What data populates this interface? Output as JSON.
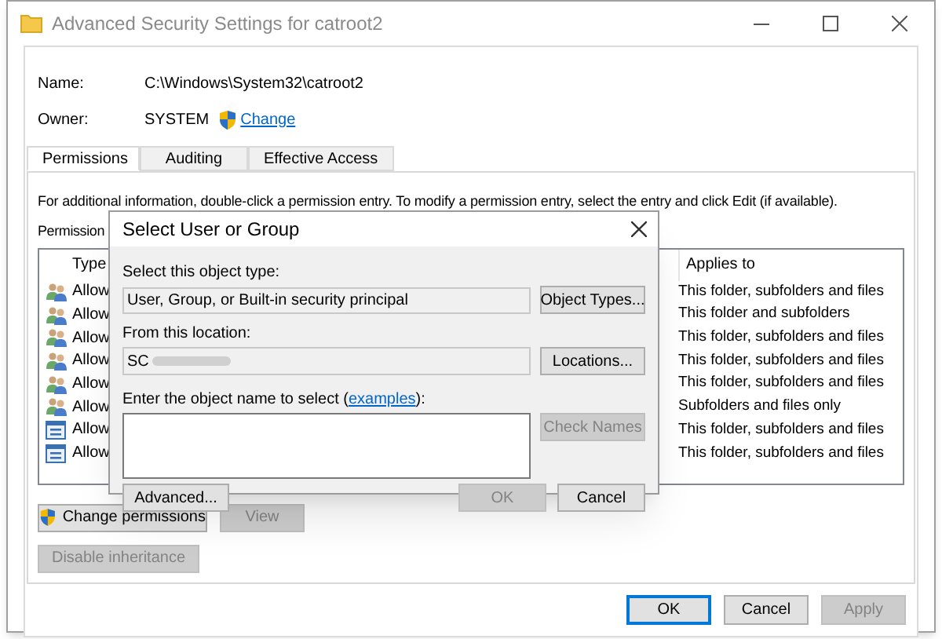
{
  "window": {
    "title": "Advanced Security Settings for catroot2"
  },
  "name": {
    "label": "Name:",
    "value": "C:\\Windows\\System32\\catroot2"
  },
  "owner": {
    "label": "Owner:",
    "value": "SYSTEM",
    "link": "Change"
  },
  "tabs": [
    {
      "label": "Permissions",
      "selected": true
    },
    {
      "label": "Auditing",
      "selected": false
    },
    {
      "label": "Effective Access",
      "selected": false
    }
  ],
  "info": "For additional information, double-click a permission entry. To modify a permission entry, select the entry and click Edit (if available).",
  "entries_label": "Permission",
  "table": {
    "columns": [
      "Type",
      "Applies to"
    ],
    "rows": [
      {
        "kind": "group",
        "type": "Allow",
        "applies_to": "This folder, subfolders and files"
      },
      {
        "kind": "group",
        "type": "Allow",
        "applies_to": "This folder and subfolders"
      },
      {
        "kind": "group",
        "type": "Allow",
        "applies_to": "This folder, subfolders and files"
      },
      {
        "kind": "group",
        "type": "Allow",
        "applies_to": "This folder, subfolders and files"
      },
      {
        "kind": "group",
        "type": "Allow",
        "applies_to": "This folder, subfolders and files"
      },
      {
        "kind": "group",
        "type": "Allow",
        "applies_to": "Subfolders and files only"
      },
      {
        "kind": "package",
        "type": "Allow",
        "applies_to": "This folder, subfolders and files"
      },
      {
        "kind": "package",
        "type": "Allow",
        "applies_to": "This folder, subfolders and files"
      }
    ]
  },
  "panel_buttons": [
    {
      "label": "Change permissions",
      "shield": true,
      "disabled": false
    },
    {
      "label": "View",
      "shield": false,
      "disabled": true
    }
  ],
  "inheritance_button": {
    "label": "Disable inheritance",
    "disabled": true
  },
  "footer_buttons": [
    {
      "label": "OK",
      "default": true,
      "disabled": false
    },
    {
      "label": "Cancel",
      "default": false,
      "disabled": false
    },
    {
      "label": "Apply",
      "default": false,
      "disabled": true
    }
  ],
  "dialog": {
    "title": "Select User or Group",
    "object_type_label": "Select this object type:",
    "object_type": "User, Group, or Built-in security principal",
    "object_types_button": {
      "label": "Object Types...",
      "disabled": false
    },
    "location_label": "From this location:",
    "location": "SC",
    "locations_button": {
      "label": "Locations...",
      "disabled": false
    },
    "name_label": "Enter the object name to select (",
    "name_link": "examples",
    "name_label_end": "):",
    "check_names_button": {
      "label": "Check Names",
      "disabled": true
    },
    "advanced_button": {
      "label": "Advanced...",
      "disabled": false
    },
    "buttons": [
      {
        "label": "OK",
        "disabled": true
      },
      {
        "label": "Cancel",
        "disabled": false
      }
    ]
  }
}
